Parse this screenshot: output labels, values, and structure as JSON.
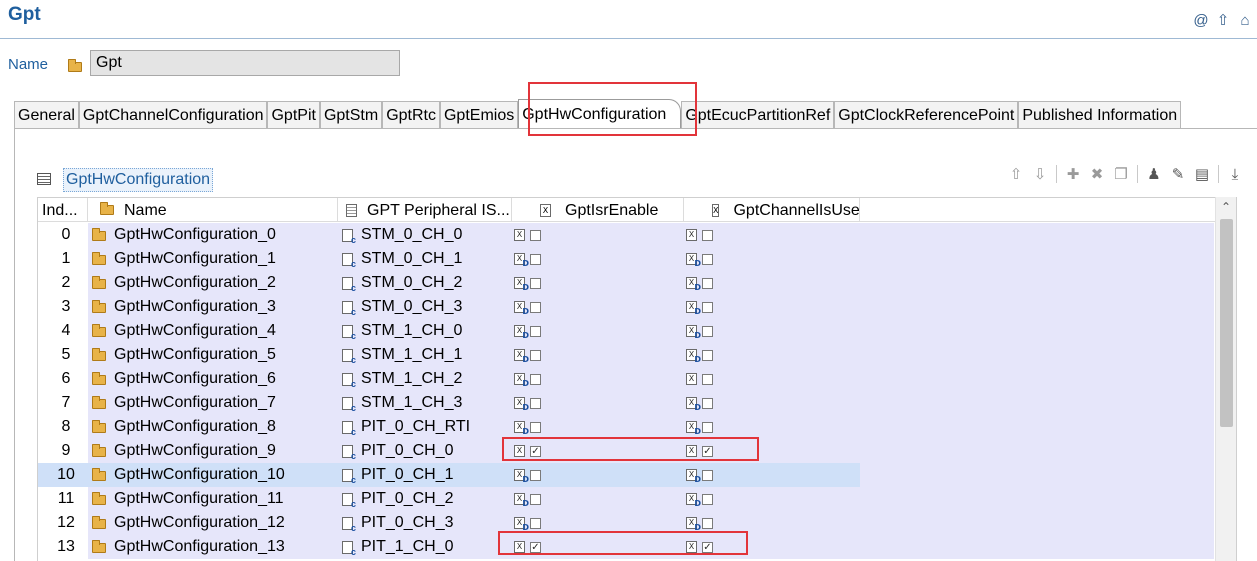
{
  "editor": {
    "title": "Gpt",
    "icons": [
      "at-icon",
      "up-arrow-icon",
      "home-icon"
    ]
  },
  "name_field": {
    "label": "Name",
    "value": "Gpt"
  },
  "tabs": [
    {
      "label": "General"
    },
    {
      "label": "GptChannelConfiguration"
    },
    {
      "label": "GptPit"
    },
    {
      "label": "GptStm"
    },
    {
      "label": "GptRtc"
    },
    {
      "label": "GptEmios"
    },
    {
      "label": "GptHwConfiguration",
      "active": true
    },
    {
      "label": "GptEcucPartitionRef"
    },
    {
      "label": "GptClockReferencePoint"
    },
    {
      "label": "Published Information"
    }
  ],
  "section": {
    "title": "GptHwConfiguration",
    "toolbar": [
      "move-up-icon",
      "move-down-icon",
      "add-icon",
      "delete-icon",
      "copy-icon",
      "wizard-icon",
      "edit-icon",
      "edit-all-icon",
      "export-icon"
    ]
  },
  "table": {
    "columns": [
      "Ind...",
      "Name",
      "GPT Peripheral IS...",
      "GptIsrEnable",
      "GptChannelIsUsed"
    ],
    "rows": [
      {
        "index": "0",
        "name": "GptHwConfiguration_0",
        "peripheral": "STM_0_CH_0",
        "isr_enable": false,
        "channel_used": false,
        "isr_default": false,
        "used_default": false
      },
      {
        "index": "1",
        "name": "GptHwConfiguration_1",
        "peripheral": "STM_0_CH_1",
        "isr_enable": false,
        "channel_used": false,
        "isr_default": true,
        "used_default": true
      },
      {
        "index": "2",
        "name": "GptHwConfiguration_2",
        "peripheral": "STM_0_CH_2",
        "isr_enable": false,
        "channel_used": false,
        "isr_default": true,
        "used_default": true
      },
      {
        "index": "3",
        "name": "GptHwConfiguration_3",
        "peripheral": "STM_0_CH_3",
        "isr_enable": false,
        "channel_used": false,
        "isr_default": true,
        "used_default": true
      },
      {
        "index": "4",
        "name": "GptHwConfiguration_4",
        "peripheral": "STM_1_CH_0",
        "isr_enable": false,
        "channel_used": false,
        "isr_default": true,
        "used_default": true
      },
      {
        "index": "5",
        "name": "GptHwConfiguration_5",
        "peripheral": "STM_1_CH_1",
        "isr_enable": false,
        "channel_used": false,
        "isr_default": true,
        "used_default": true
      },
      {
        "index": "6",
        "name": "GptHwConfiguration_6",
        "peripheral": "STM_1_CH_2",
        "isr_enable": false,
        "channel_used": false,
        "isr_default": true,
        "used_default": false
      },
      {
        "index": "7",
        "name": "GptHwConfiguration_7",
        "peripheral": "STM_1_CH_3",
        "isr_enable": false,
        "channel_used": false,
        "isr_default": true,
        "used_default": true
      },
      {
        "index": "8",
        "name": "GptHwConfiguration_8",
        "peripheral": "PIT_0_CH_RTI",
        "isr_enable": false,
        "channel_used": false,
        "isr_default": true,
        "used_default": true
      },
      {
        "index": "9",
        "name": "GptHwConfiguration_9",
        "peripheral": "PIT_0_CH_0",
        "isr_enable": true,
        "channel_used": true,
        "isr_default": false,
        "used_default": false
      },
      {
        "index": "10",
        "name": "GptHwConfiguration_10",
        "peripheral": "PIT_0_CH_1",
        "isr_enable": false,
        "channel_used": false,
        "isr_default": true,
        "used_default": true,
        "selected": true
      },
      {
        "index": "11",
        "name": "GptHwConfiguration_11",
        "peripheral": "PIT_0_CH_2",
        "isr_enable": false,
        "channel_used": false,
        "isr_default": true,
        "used_default": true
      },
      {
        "index": "12",
        "name": "GptHwConfiguration_12",
        "peripheral": "PIT_0_CH_3",
        "isr_enable": false,
        "channel_used": false,
        "isr_default": true,
        "used_default": true
      },
      {
        "index": "13",
        "name": "GptHwConfiguration_13",
        "peripheral": "PIT_1_CH_0",
        "isr_enable": true,
        "channel_used": true,
        "isr_default": false,
        "used_default": false
      }
    ]
  },
  "colors": {
    "title_blue": "#1f5f9e",
    "row_bg": "#e6e6fa",
    "selected_row_bg": "#cfe0f8",
    "highlight_red": "#e2343a"
  }
}
